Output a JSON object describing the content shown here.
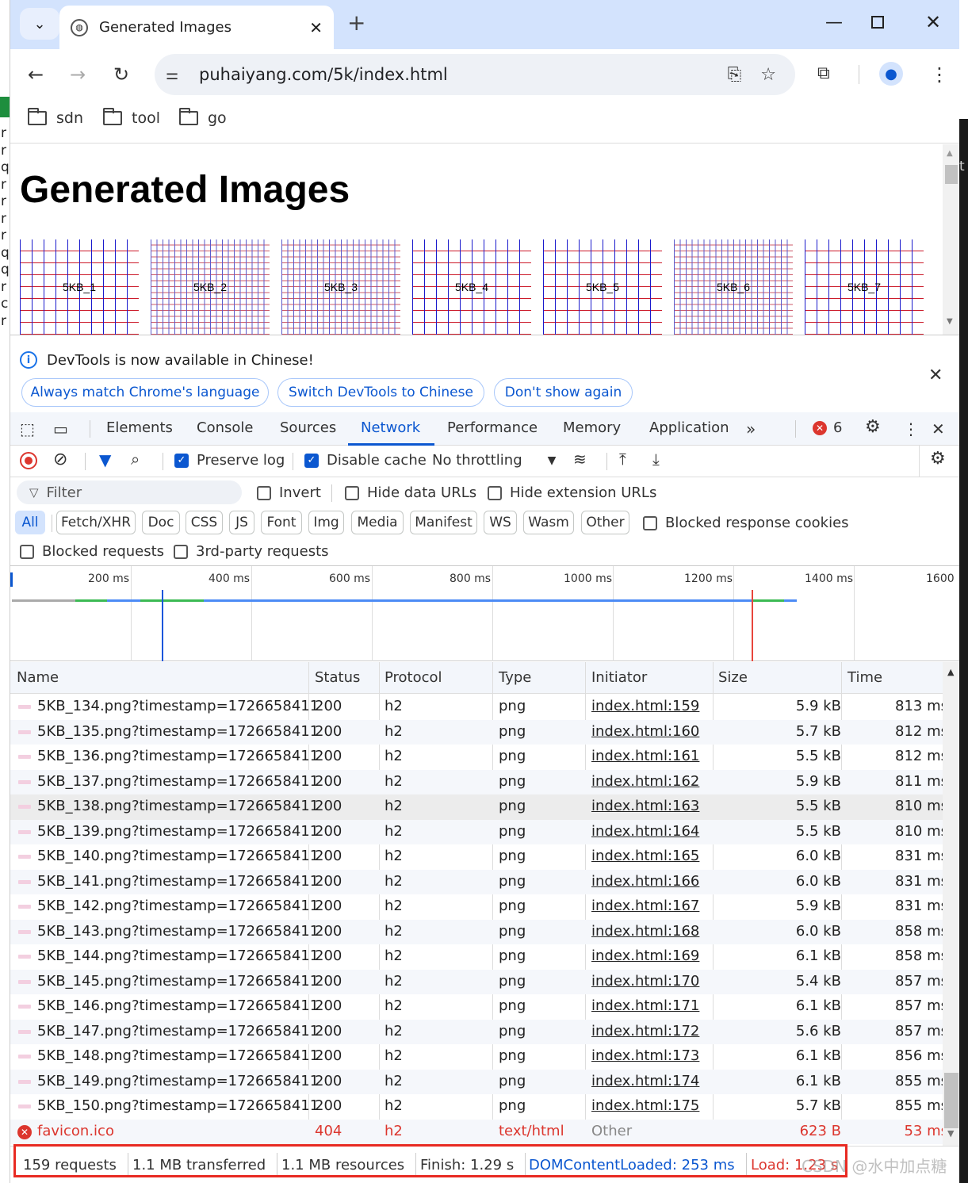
{
  "browser": {
    "tab_title": "Generated Images",
    "url": "puhaiyang.com/5k/index.html",
    "bookmarks": [
      "sdn",
      "tool",
      "go"
    ]
  },
  "side_text": [
    "r",
    "r",
    "q",
    "r",
    "r",
    "r",
    "r",
    "q",
    "q",
    "r",
    "c",
    "r"
  ],
  "right_text": "t",
  "page": {
    "heading": "Generated Images",
    "thumbnails": [
      "5KB_1",
      "5KB_2",
      "5KB_3",
      "5KB_4",
      "5KB_5",
      "5KB_6",
      "5KB_7"
    ]
  },
  "infobar": {
    "message": "DevTools is now available in Chinese!",
    "buttons": [
      "Always match Chrome's language",
      "Switch DevTools to Chinese",
      "Don't show again"
    ]
  },
  "devtools": {
    "tabs": [
      "Elements",
      "Console",
      "Sources",
      "Network",
      "Performance",
      "Memory",
      "Application"
    ],
    "active_tab": "Network",
    "error_count": "6",
    "preserve_log": "Preserve log",
    "disable_cache": "Disable cache",
    "throttling": "No throttling",
    "filter_placeholder": "Filter",
    "invert": "Invert",
    "hide_data_urls": "Hide data URLs",
    "hide_extension_urls": "Hide extension URLs",
    "type_filters": [
      "All",
      "Fetch/XHR",
      "Doc",
      "CSS",
      "JS",
      "Font",
      "Img",
      "Media",
      "Manifest",
      "WS",
      "Wasm",
      "Other"
    ],
    "blocked_response_cookies": "Blocked response cookies",
    "blocked_requests": "Blocked requests",
    "third_party_requests": "3rd-party requests",
    "timeline_labels": [
      "200 ms",
      "400 ms",
      "600 ms",
      "800 ms",
      "1000 ms",
      "1200 ms",
      "1400 ms",
      "1600"
    ],
    "columns": [
      "Name",
      "Status",
      "Protocol",
      "Type",
      "Initiator",
      "Size",
      "Time"
    ],
    "rows": [
      {
        "name": "5KB_134.png?timestamp=1726658411",
        "status": "200",
        "protocol": "h2",
        "type": "png",
        "initiator": "index.html:159",
        "size": "5.9 kB",
        "time": "813 ms"
      },
      {
        "name": "5KB_135.png?timestamp=1726658411",
        "status": "200",
        "protocol": "h2",
        "type": "png",
        "initiator": "index.html:160",
        "size": "5.7 kB",
        "time": "812 ms"
      },
      {
        "name": "5KB_136.png?timestamp=1726658411",
        "status": "200",
        "protocol": "h2",
        "type": "png",
        "initiator": "index.html:161",
        "size": "5.5 kB",
        "time": "812 ms"
      },
      {
        "name": "5KB_137.png?timestamp=1726658411",
        "status": "200",
        "protocol": "h2",
        "type": "png",
        "initiator": "index.html:162",
        "size": "5.9 kB",
        "time": "811 ms"
      },
      {
        "name": "5KB_138.png?timestamp=1726658411",
        "status": "200",
        "protocol": "h2",
        "type": "png",
        "initiator": "index.html:163",
        "size": "5.5 kB",
        "time": "810 ms"
      },
      {
        "name": "5KB_139.png?timestamp=1726658411",
        "status": "200",
        "protocol": "h2",
        "type": "png",
        "initiator": "index.html:164",
        "size": "5.5 kB",
        "time": "810 ms"
      },
      {
        "name": "5KB_140.png?timestamp=1726658411",
        "status": "200",
        "protocol": "h2",
        "type": "png",
        "initiator": "index.html:165",
        "size": "6.0 kB",
        "time": "831 ms"
      },
      {
        "name": "5KB_141.png?timestamp=1726658411",
        "status": "200",
        "protocol": "h2",
        "type": "png",
        "initiator": "index.html:166",
        "size": "6.0 kB",
        "time": "831 ms"
      },
      {
        "name": "5KB_142.png?timestamp=1726658411",
        "status": "200",
        "protocol": "h2",
        "type": "png",
        "initiator": "index.html:167",
        "size": "5.9 kB",
        "time": "831 ms"
      },
      {
        "name": "5KB_143.png?timestamp=1726658411",
        "status": "200",
        "protocol": "h2",
        "type": "png",
        "initiator": "index.html:168",
        "size": "6.0 kB",
        "time": "858 ms"
      },
      {
        "name": "5KB_144.png?timestamp=1726658411",
        "status": "200",
        "protocol": "h2",
        "type": "png",
        "initiator": "index.html:169",
        "size": "6.1 kB",
        "time": "858 ms"
      },
      {
        "name": "5KB_145.png?timestamp=1726658411",
        "status": "200",
        "protocol": "h2",
        "type": "png",
        "initiator": "index.html:170",
        "size": "5.4 kB",
        "time": "857 ms"
      },
      {
        "name": "5KB_146.png?timestamp=1726658411",
        "status": "200",
        "protocol": "h2",
        "type": "png",
        "initiator": "index.html:171",
        "size": "6.1 kB",
        "time": "857 ms"
      },
      {
        "name": "5KB_147.png?timestamp=1726658411",
        "status": "200",
        "protocol": "h2",
        "type": "png",
        "initiator": "index.html:172",
        "size": "5.6 kB",
        "time": "857 ms"
      },
      {
        "name": "5KB_148.png?timestamp=1726658411",
        "status": "200",
        "protocol": "h2",
        "type": "png",
        "initiator": "index.html:173",
        "size": "6.1 kB",
        "time": "856 ms"
      },
      {
        "name": "5KB_149.png?timestamp=1726658411",
        "status": "200",
        "protocol": "h2",
        "type": "png",
        "initiator": "index.html:174",
        "size": "6.1 kB",
        "time": "855 ms"
      },
      {
        "name": "5KB_150.png?timestamp=1726658411",
        "status": "200",
        "protocol": "h2",
        "type": "png",
        "initiator": "index.html:175",
        "size": "5.7 kB",
        "time": "855 ms"
      },
      {
        "name": "favicon.ico",
        "status": "404",
        "protocol": "h2",
        "type": "text/html",
        "initiator": "Other",
        "size": "623 B",
        "time": "53 ms",
        "error": true
      }
    ],
    "status_bar": [
      "159 requests",
      "1.1 MB transferred",
      "1.1 MB resources",
      "Finish: 1.29 s",
      "DOMContentLoaded: 253 ms",
      "Load: 1.23 s"
    ]
  },
  "watermark": "CSDN @水中加点糖",
  "colors": {
    "accent": "#0b57d0",
    "error": "#dc362e",
    "highlight": "#e82a22",
    "tabstrip": "#d3e3fd"
  }
}
